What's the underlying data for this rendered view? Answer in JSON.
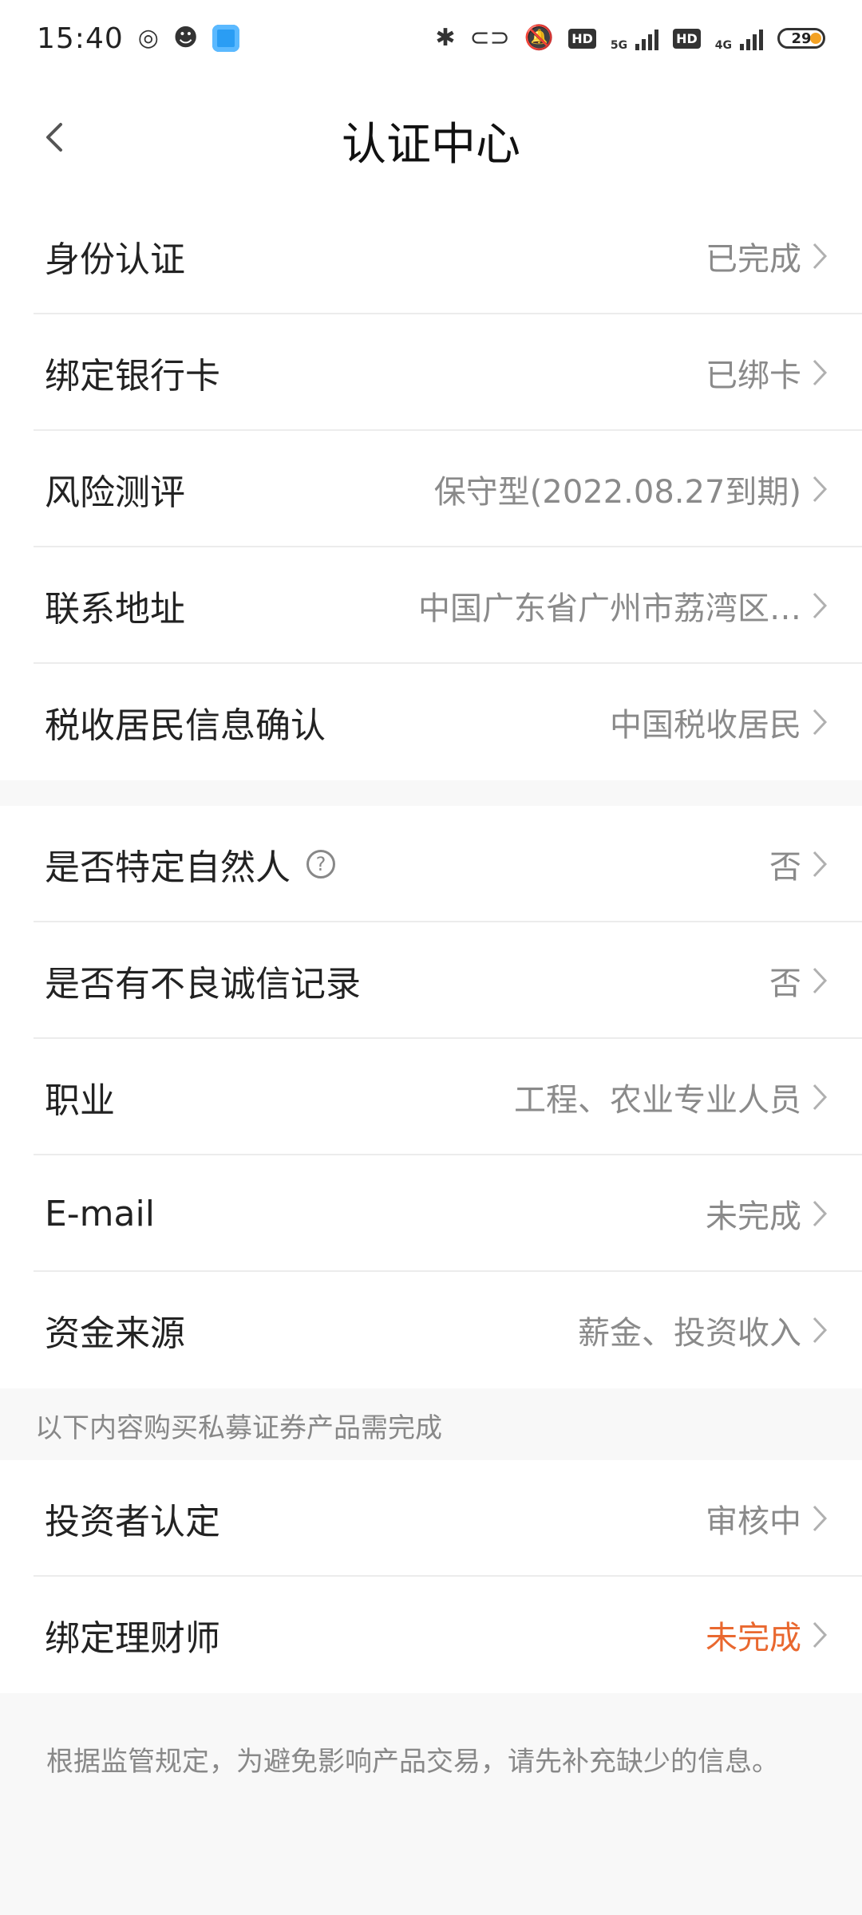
{
  "status_bar": {
    "time": "15:40",
    "battery": "29",
    "network_5g": "5G",
    "network_4g": "4G",
    "hd1": "HD",
    "hd2": "HD"
  },
  "header": {
    "title": "认证中心",
    "back_icon": "chevron-left-icon"
  },
  "section1": {
    "items": [
      {
        "label": "身份认证",
        "value": "已完成"
      },
      {
        "label": "绑定银行卡",
        "value": "已绑卡"
      },
      {
        "label": "风险测评",
        "value": "保守型(2022.08.27到期)"
      },
      {
        "label": "联系地址",
        "value": "中国广东省广州市荔湾区…"
      },
      {
        "label": "税收居民信息确认",
        "value": "中国税收居民"
      }
    ]
  },
  "section2": {
    "items": [
      {
        "label": "是否特定自然人",
        "value": "否"
      },
      {
        "label": "是否有不良诚信记录",
        "value": "否"
      },
      {
        "label": "职业",
        "value": "工程、农业专业人员"
      },
      {
        "label": "E-mail",
        "value": "未完成"
      },
      {
        "label": "资金来源",
        "value": "薪金、投资收入"
      }
    ]
  },
  "private_note": "以下内容购买私募证券产品需完成",
  "section3": {
    "items": [
      {
        "label": "投资者认定",
        "value": "审核中"
      },
      {
        "label": "绑定理财师",
        "value": "未完成",
        "value_color": "#e9682f"
      }
    ]
  },
  "footer_note": "根据监管规定，为避免影响产品交易，请先补充缺少的信息。",
  "colors": {
    "accent_orange": "#e9682f",
    "value_gray": "#8a8a8a",
    "background": "#f8f8f8"
  }
}
